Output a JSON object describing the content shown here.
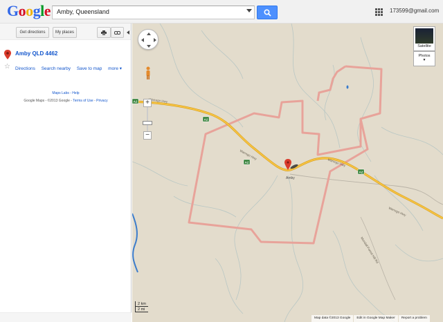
{
  "header": {
    "logo": "Google",
    "search_value": "Amby, Queensland",
    "account": "173599@gmail.com"
  },
  "panel": {
    "get_directions": "Get directions",
    "my_places": "My places",
    "place_title": "Amby QLD 4462",
    "actions": {
      "directions": "Directions",
      "search_nearby": "Search nearby",
      "save_to_map": "Save to map",
      "more": "more"
    },
    "links": "Maps Labs - Help",
    "copyright": "Google Maps - ©2013 Google - ",
    "terms": "Terms of Use",
    "privacy": "Privacy"
  },
  "map": {
    "satellite_label": "Satellite",
    "photos_label": "Photos",
    "scale_km": "2 km",
    "scale_mi": "2 mi",
    "zoom_plus": "+",
    "zoom_minus": "−",
    "footer": {
      "map_data": "Map data ©2013 Google",
      "edit": "Edit in Google Map Maker",
      "report": "Report a problem"
    },
    "roads": [
      {
        "label": "A2"
      },
      {
        "label": "Warrego Hwy"
      },
      {
        "label": "Mitchell-Forest Hill Rd"
      },
      {
        "label": "Murilla Rd"
      },
      {
        "label": "Mundall Forest Hill Rd"
      }
    ],
    "town_label": "Amby",
    "colors": {
      "land": "#e3dccc",
      "road": "#f2b31f",
      "boundary": "#e8a39a",
      "water": "#3b7ccc",
      "marker": "#d93a2b"
    }
  },
  "icons": [
    "search-icon",
    "apps-grid-icon",
    "print-icon",
    "link-icon",
    "location-pin-icon",
    "star-icon",
    "pan-control-icon",
    "pegman-icon",
    "collapse-arrow-icon"
  ]
}
